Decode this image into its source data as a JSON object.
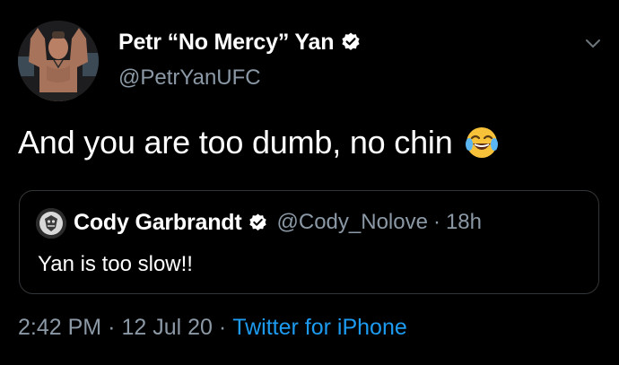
{
  "author": {
    "display_name": "Petr “No Mercy” Yan",
    "handle": "@PetrYanUFC",
    "verified": true,
    "avatar_icon": "fighter-photo-avatar"
  },
  "tweet": {
    "text": "And you are too dumb, no chin",
    "emoji": "face-with-tears-of-joy"
  },
  "quoted": {
    "display_name": "Cody Garbrandt",
    "handle": "@Cody_Nolove",
    "separator": "·",
    "time": "18h",
    "text": "Yan is too slow!!",
    "verified": true
  },
  "meta": {
    "time": "2:42 PM",
    "separator": "·",
    "date": "12 Jul 20",
    "source": "Twitter for iPhone"
  },
  "colors": {
    "background": "#000000",
    "text_primary": "#ffffff",
    "text_secondary": "#8b98a5",
    "link": "#1d9bf0",
    "border": "#333639"
  }
}
